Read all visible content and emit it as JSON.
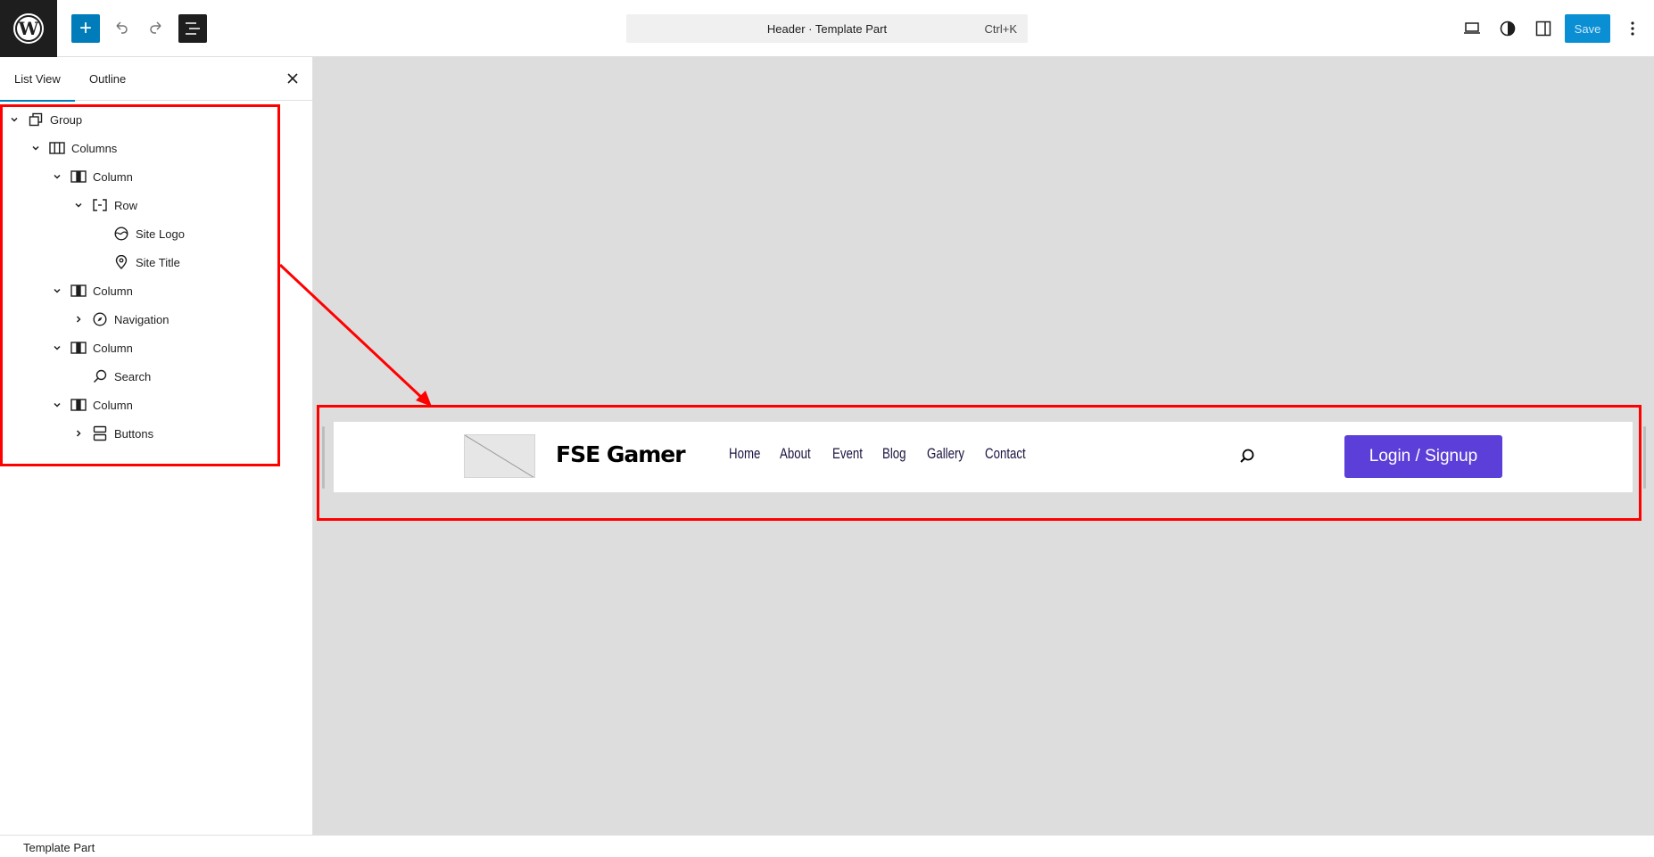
{
  "topbar": {
    "command_title": "Header · Template Part",
    "shortcut": "Ctrl+K",
    "save_label": "Save",
    "add_label": "+",
    "accent_color": "#007cba"
  },
  "sidebar": {
    "tabs": [
      {
        "label": "List View",
        "active": true
      },
      {
        "label": "Outline",
        "active": false
      }
    ],
    "tree": [
      {
        "label": "Group",
        "icon": "group-icon",
        "expanded": true
      },
      {
        "label": "Columns",
        "icon": "columns-icon",
        "expanded": true
      },
      {
        "label": "Column",
        "icon": "column-icon",
        "expanded": true
      },
      {
        "label": "Row",
        "icon": "row-icon",
        "expanded": true
      },
      {
        "label": "Site Logo",
        "icon": "site-logo-icon"
      },
      {
        "label": "Site Title",
        "icon": "map-marker-icon"
      },
      {
        "label": "Column",
        "icon": "column-icon",
        "expanded": true
      },
      {
        "label": "Navigation",
        "icon": "navigation-icon",
        "expanded": false
      },
      {
        "label": "Column",
        "icon": "column-icon",
        "expanded": true
      },
      {
        "label": "Search",
        "icon": "search-icon"
      },
      {
        "label": "Column",
        "icon": "column-icon",
        "expanded": true
      },
      {
        "label": "Buttons",
        "icon": "buttons-icon",
        "expanded": false
      }
    ]
  },
  "preview": {
    "site_title": "FSE Gamer",
    "nav_items": [
      "Home",
      "About",
      "Event",
      "Blog",
      "Gallery",
      "Contact"
    ],
    "button_label": "Login / Signup",
    "button_color": "#5b3fd8"
  },
  "footer": {
    "breadcrumb": "Template Part"
  }
}
